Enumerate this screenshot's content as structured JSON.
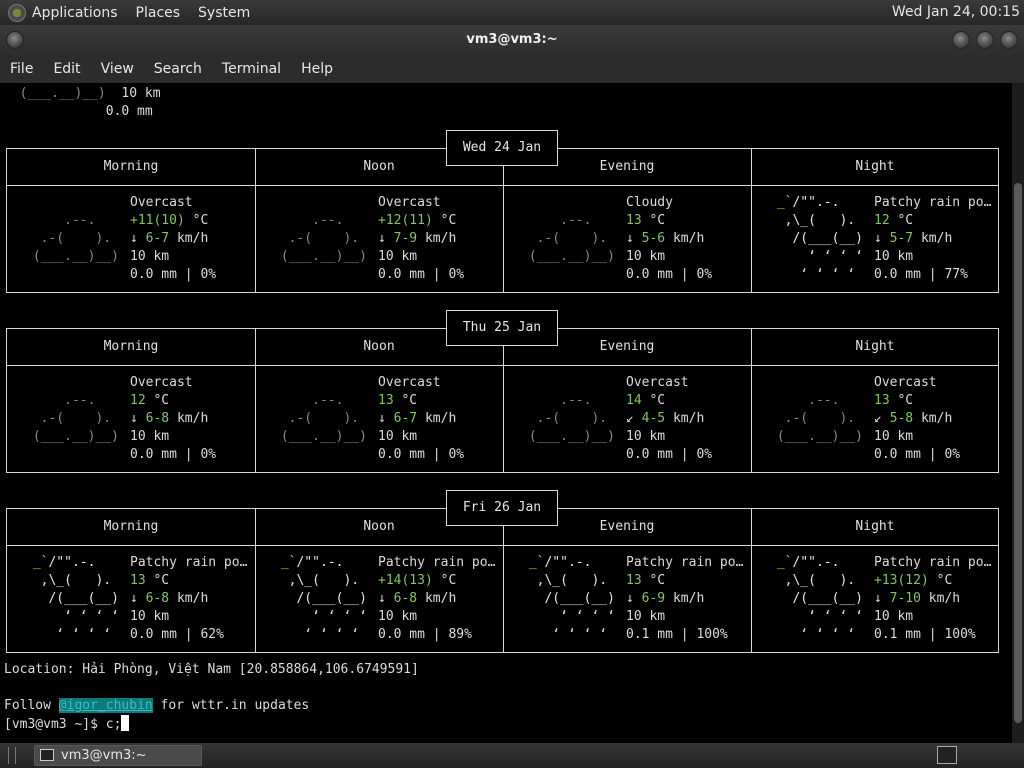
{
  "panel": {
    "menus": [
      "Applications",
      "Places",
      "System"
    ],
    "clock": "Wed Jan 24, 00:15"
  },
  "window": {
    "title": "vm3@vm3:~"
  },
  "menubar": [
    "File",
    "Edit",
    "View",
    "Search",
    "Terminal",
    "Help"
  ],
  "top_lines": [
    "(___.__)__)  10 km",
    "             0.0 mm"
  ],
  "days": [
    {
      "label": "Wed 24 Jan",
      "periods": [
        {
          "name": "Morning",
          "type": "cloud",
          "cond": "Overcast",
          "temp": "+11(10)",
          "unit": " °C",
          "wind_dir": "↓",
          "wind": "6-7",
          "wind_unit": " km/h",
          "vis": "10 km",
          "precip": "0.0 mm | 0%"
        },
        {
          "name": "Noon",
          "type": "cloud",
          "cond": "Overcast",
          "temp": "+12(11)",
          "unit": " °C",
          "wind_dir": "↓",
          "wind": "7-9",
          "wind_unit": " km/h",
          "vis": "10 km",
          "precip": "0.0 mm | 0%"
        },
        {
          "name": "Evening",
          "type": "cloud",
          "cond": "Cloudy",
          "temp": "13",
          "unit": " °C",
          "wind_dir": "↓",
          "wind": "5-6",
          "wind_unit": " km/h",
          "vis": "10 km",
          "precip": "0.0 mm | 0%"
        },
        {
          "name": "Night",
          "type": "rain",
          "cond": "Patchy rain po…",
          "temp": "12",
          "unit": " °C",
          "wind_dir": "↓",
          "wind": "5-7",
          "wind_unit": " km/h",
          "vis": "10 km",
          "precip": "0.0 mm | 77%"
        }
      ]
    },
    {
      "label": "Thu 25 Jan",
      "periods": [
        {
          "name": "Morning",
          "type": "cloud",
          "cond": "Overcast",
          "temp": "12",
          "unit": " °C",
          "wind_dir": "↓",
          "wind": "6-8",
          "wind_unit": " km/h",
          "vis": "10 km",
          "precip": "0.0 mm | 0%"
        },
        {
          "name": "Noon",
          "type": "cloud",
          "cond": "Overcast",
          "temp": "13",
          "unit": " °C",
          "wind_dir": "↓",
          "wind": "6-7",
          "wind_unit": " km/h",
          "vis": "10 km",
          "precip": "0.0 mm | 0%"
        },
        {
          "name": "Evening",
          "type": "cloud",
          "cond": "Overcast",
          "temp": "14",
          "unit": " °C",
          "wind_dir": "↙",
          "wind": "4-5",
          "wind_unit": " km/h",
          "vis": "10 km",
          "precip": "0.0 mm | 0%"
        },
        {
          "name": "Night",
          "type": "cloud",
          "cond": "Overcast",
          "temp": "13",
          "unit": " °C",
          "wind_dir": "↙",
          "wind": "5-8",
          "wind_unit": " km/h",
          "vis": "10 km",
          "precip": "0.0 mm | 0%"
        }
      ]
    },
    {
      "label": "Fri 26 Jan",
      "periods": [
        {
          "name": "Morning",
          "type": "rain",
          "cond": "Patchy rain po…",
          "temp": "13",
          "unit": " °C",
          "wind_dir": "↓",
          "wind": "6-8",
          "wind_unit": " km/h",
          "vis": "10 km",
          "precip": "0.0 mm | 62%"
        },
        {
          "name": "Noon",
          "type": "rain",
          "cond": "Patchy rain po…",
          "temp": "+14(13)",
          "unit": " °C",
          "wind_dir": "↓",
          "wind": "6-8",
          "wind_unit": " km/h",
          "vis": "10 km",
          "precip": "0.0 mm | 89%"
        },
        {
          "name": "Evening",
          "type": "rain",
          "cond": "Patchy rain po…",
          "temp": "13",
          "unit": " °C",
          "wind_dir": "↓",
          "wind": "6-9",
          "wind_unit": " km/h",
          "vis": "10 km",
          "precip": "0.1 mm | 100%"
        },
        {
          "name": "Night",
          "type": "rain",
          "cond": "Patchy rain po…",
          "temp": "+13(12)",
          "unit": " °C",
          "wind_dir": "↓",
          "wind": "7-10",
          "wind_unit": " km/h",
          "vis": "10 km",
          "precip": "0.1 mm | 100%"
        }
      ]
    }
  ],
  "location": "Location: Hải Phòng, Việt Nam [20.858864,106.6749591]",
  "follow": {
    "before": "Follow ",
    "handle": "@igor_chubin",
    "after": " for wttr.in updates"
  },
  "prompt": "[vm3@vm3 ~]$ c;",
  "taskbar": {
    "task_label": "vm3@vm3:~"
  },
  "art": {
    "cloud": [
      "     .--.    ",
      "  .-(    ).  ",
      " (___.__)__) "
    ],
    "rain": [
      " _`/\"\".-.    ",
      "  ,\\_(   ).  ",
      "   /(___(__) ",
      "     ‘ ‘ ‘ ‘ ",
      "    ‘ ‘ ‘ ‘  "
    ]
  },
  "colors": {
    "green": "#7fc85a",
    "yellow": "#e3d21d",
    "link_bg": "#0f7a7a"
  }
}
